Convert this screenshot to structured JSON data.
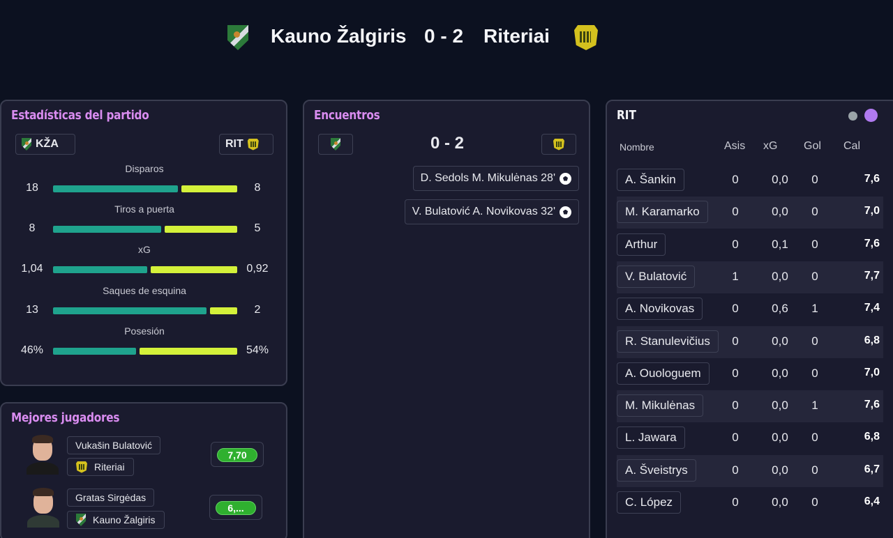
{
  "header": {
    "home": "Kauno Žalgiris",
    "score": "0 - 2",
    "away": "Riteriai"
  },
  "stats": {
    "title": "Estadísticas del partido",
    "home_abbr": "KŽA",
    "away_abbr": "RIT",
    "rows": [
      {
        "label": "Disparos",
        "home": "18",
        "away": "8",
        "home_share": 0.69
      },
      {
        "label": "Tiros a puerta",
        "home": "8",
        "away": "5",
        "home_share": 0.6
      },
      {
        "label": "xG",
        "home": "1,04",
        "away": "0,92",
        "home_share": 0.52
      },
      {
        "label": "Saques de esquina",
        "home": "13",
        "away": "2",
        "home_share": 0.85
      },
      {
        "label": "Posesión",
        "home": "46%",
        "away": "54%",
        "home_share": 0.46
      }
    ]
  },
  "best": {
    "title": "Mejores jugadores",
    "players": [
      {
        "name": "Vukašin Bulatović",
        "team": "Riteriai",
        "rating": "7,70"
      },
      {
        "name": "Gratas Sirgėdas",
        "team": "Kauno Žalgiris",
        "rating": "6,..."
      }
    ]
  },
  "encounters": {
    "title": "Encuentros",
    "score": "0 - 2",
    "events": [
      {
        "text": "D. Sedols  M. Mikulėnas 28'"
      },
      {
        "text": "V. Bulatović  A. Novikovas 32'"
      }
    ]
  },
  "table": {
    "title": "RIT",
    "headers": {
      "name": "Nombre",
      "asis": "Asis",
      "xg": "xG",
      "gol": "Gol",
      "cal": "Cal"
    },
    "colors": {
      "dot_grey": "#9aa3a8",
      "dot_purple": "#b07af0"
    },
    "rows": [
      {
        "name": "A. Šankin",
        "asis": "0",
        "xg": "0,0",
        "gol": "0",
        "cal": "7,6"
      },
      {
        "name": "M. Karamarko",
        "asis": "0",
        "xg": "0,0",
        "gol": "0",
        "cal": "7,0"
      },
      {
        "name": "Arthur",
        "asis": "0",
        "xg": "0,1",
        "gol": "0",
        "cal": "7,6"
      },
      {
        "name": "V. Bulatović",
        "asis": "1",
        "xg": "0,0",
        "gol": "0",
        "cal": "7,7"
      },
      {
        "name": "A. Novikovas",
        "asis": "0",
        "xg": "0,6",
        "gol": "1",
        "cal": "7,4"
      },
      {
        "name": "R. Stanulevičius",
        "asis": "0",
        "xg": "0,0",
        "gol": "0",
        "cal": "6,8"
      },
      {
        "name": "A. Ouologuem",
        "asis": "0",
        "xg": "0,0",
        "gol": "0",
        "cal": "7,0"
      },
      {
        "name": "M. Mikulėnas",
        "asis": "0",
        "xg": "0,0",
        "gol": "1",
        "cal": "7,6"
      },
      {
        "name": "L. Jawara",
        "asis": "0",
        "xg": "0,0",
        "gol": "0",
        "cal": "6,8"
      },
      {
        "name": "A. Šveistrys",
        "asis": "0",
        "xg": "0,0",
        "gol": "0",
        "cal": "6,7"
      },
      {
        "name": "C. López",
        "asis": "0",
        "xg": "0,0",
        "gol": "0",
        "cal": "6,4"
      }
    ]
  }
}
